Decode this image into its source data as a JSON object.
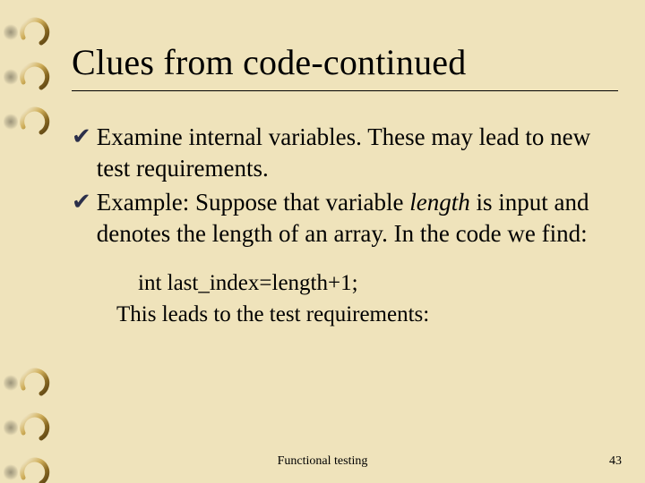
{
  "title": "Clues from code-continued",
  "bullets": [
    {
      "pre": "Examine internal variables. These may lead to new test requirements."
    },
    {
      "pre": "Example: Suppose that variable ",
      "ital": "length",
      "post": " is input and denotes the length of an array. In the code we find:"
    }
  ],
  "sub": {
    "code": "int last_index=length+1;",
    "follow": "This leads to the test requirements:"
  },
  "footer": {
    "center": "Functional testing",
    "page": "43"
  },
  "ring_positions": [
    18,
    68,
    118,
    410,
    460,
    510
  ]
}
